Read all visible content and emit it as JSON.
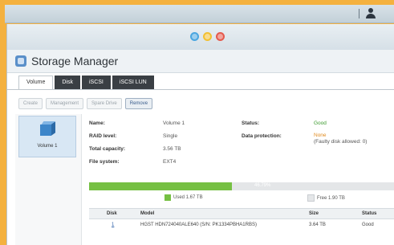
{
  "window": {
    "app_title": "Storage Manager"
  },
  "tabs": [
    "Volume",
    "Disk",
    "iSCSI",
    "iSCSI LUN"
  ],
  "toolbar": {
    "create": "Create",
    "management": "Management",
    "spare_drive": "Spare Drive",
    "remove": "Remove"
  },
  "sidebar": {
    "volume_label": "Volume 1"
  },
  "details": {
    "name_label": "Name:",
    "name_value": "Volume 1",
    "raid_label": "RAID level:",
    "raid_value": "Single",
    "capacity_label": "Total capacity:",
    "capacity_value": "3.56 TB",
    "fs_label": "File system:",
    "fs_value": "EXT4",
    "status_label": "Status:",
    "status_value": "Good",
    "protection_label": "Data protection:",
    "protection_value": "None",
    "protection_note": "(Faulty disk allowed: 0)"
  },
  "usage": {
    "percent_label": "46.79%",
    "percent": 46.79,
    "used_label": "Used 1.67 TB",
    "free_label": "Free 1.90 TB",
    "used_color": "#76c043",
    "free_color": "#e4e6e8"
  },
  "disk_table": {
    "headers": [
      "Disk",
      "Model",
      "Size",
      "Status"
    ],
    "rows": [
      {
        "disk": "1",
        "model": "HGST HDN724040ALE640 (S/N: PK1334PBHA1RBS)",
        "size": "3.64 TB",
        "status": "Good"
      }
    ]
  }
}
